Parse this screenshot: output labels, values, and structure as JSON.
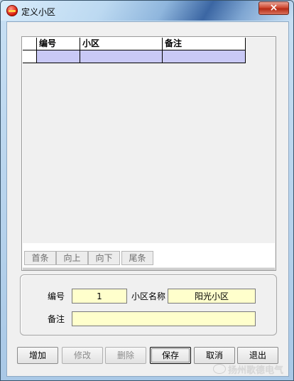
{
  "window": {
    "title": "定义小区",
    "close_glyph": "×"
  },
  "grid": {
    "columns": [
      "编号",
      "小区",
      "备注"
    ],
    "rows": [
      {
        "id": "",
        "name": "",
        "note": ""
      }
    ]
  },
  "nav": {
    "first": "首条",
    "up": "向上",
    "down": "向下",
    "last": "尾条"
  },
  "form": {
    "id_label": "编号",
    "id_value": "1",
    "name_label": "小区名称",
    "name_value": "阳光小区",
    "note_label": "备注",
    "note_value": ""
  },
  "buttons": {
    "add": "增加",
    "edit": "修改",
    "delete": "删除",
    "save": "保存",
    "cancel": "取消",
    "exit": "退出"
  },
  "watermark": "扬州歌德电气"
}
